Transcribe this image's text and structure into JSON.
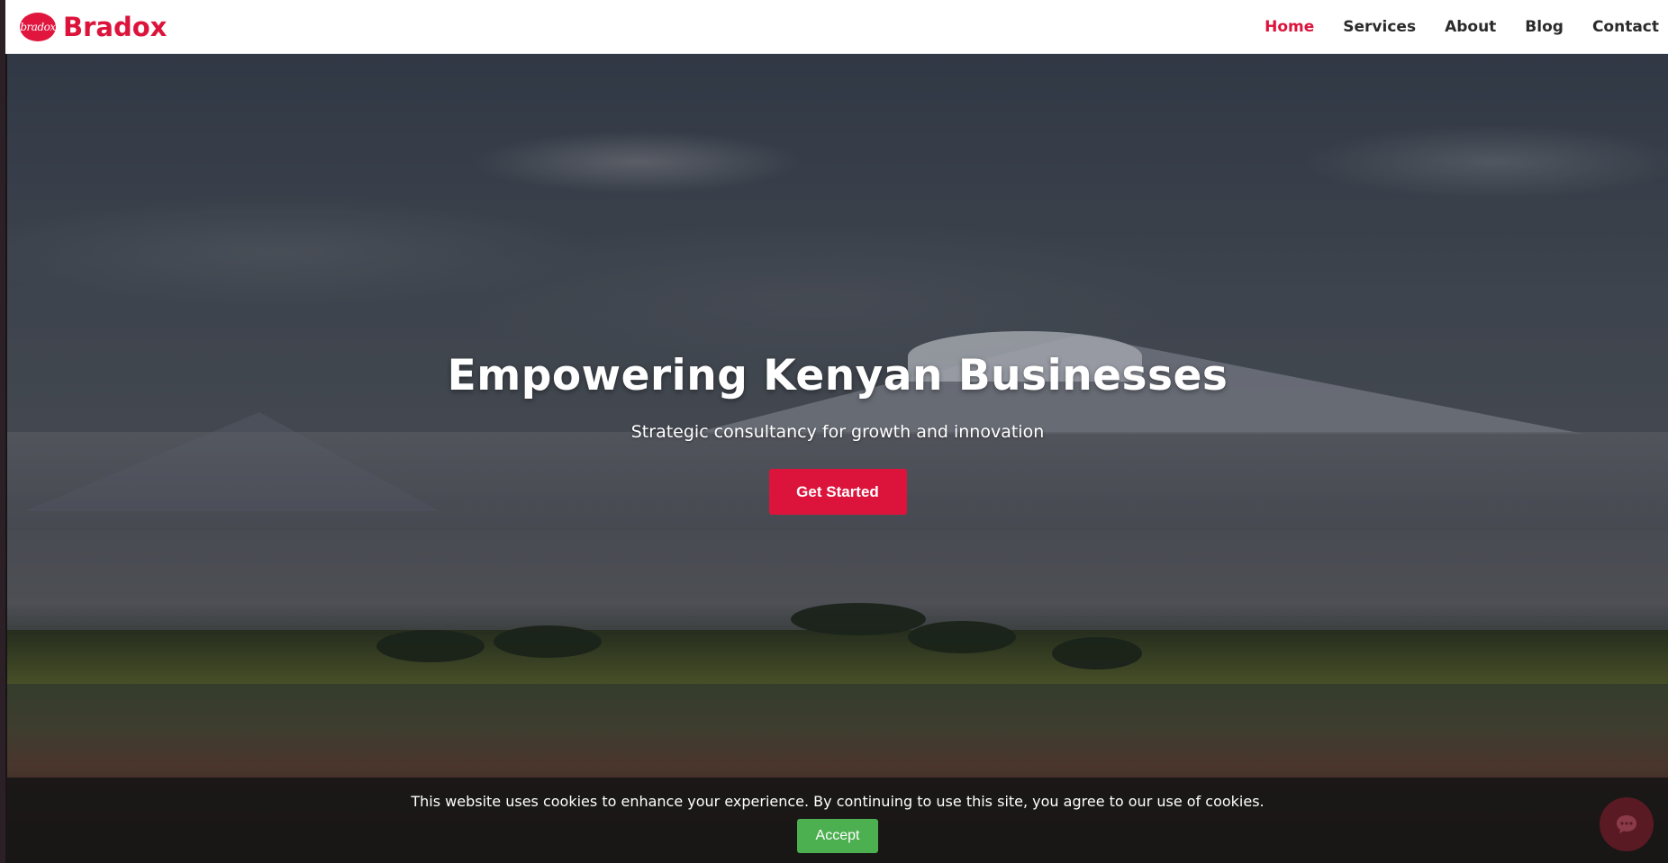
{
  "header": {
    "logo_text": "bradox",
    "brand_name": "Bradox",
    "nav": [
      {
        "label": "Home",
        "active": true
      },
      {
        "label": "Services",
        "active": false
      },
      {
        "label": "About",
        "active": false
      },
      {
        "label": "Blog",
        "active": false
      },
      {
        "label": "Contact",
        "active": false
      }
    ]
  },
  "hero": {
    "title": "Empowering Kenyan Businesses",
    "subtitle": "Strategic consultancy for growth and innovation",
    "cta_label": "Get Started"
  },
  "cookie_banner": {
    "message": "This website uses cookies to enhance your experience. By continuing to use this site, you agree to our use of cookies.",
    "accept_label": "Accept"
  },
  "chat_widget": {
    "icon": "chat-bubble-icon"
  },
  "colors": {
    "brand": "#dc143c",
    "accept": "#4caf50",
    "nav_text": "#2b2b2b"
  }
}
